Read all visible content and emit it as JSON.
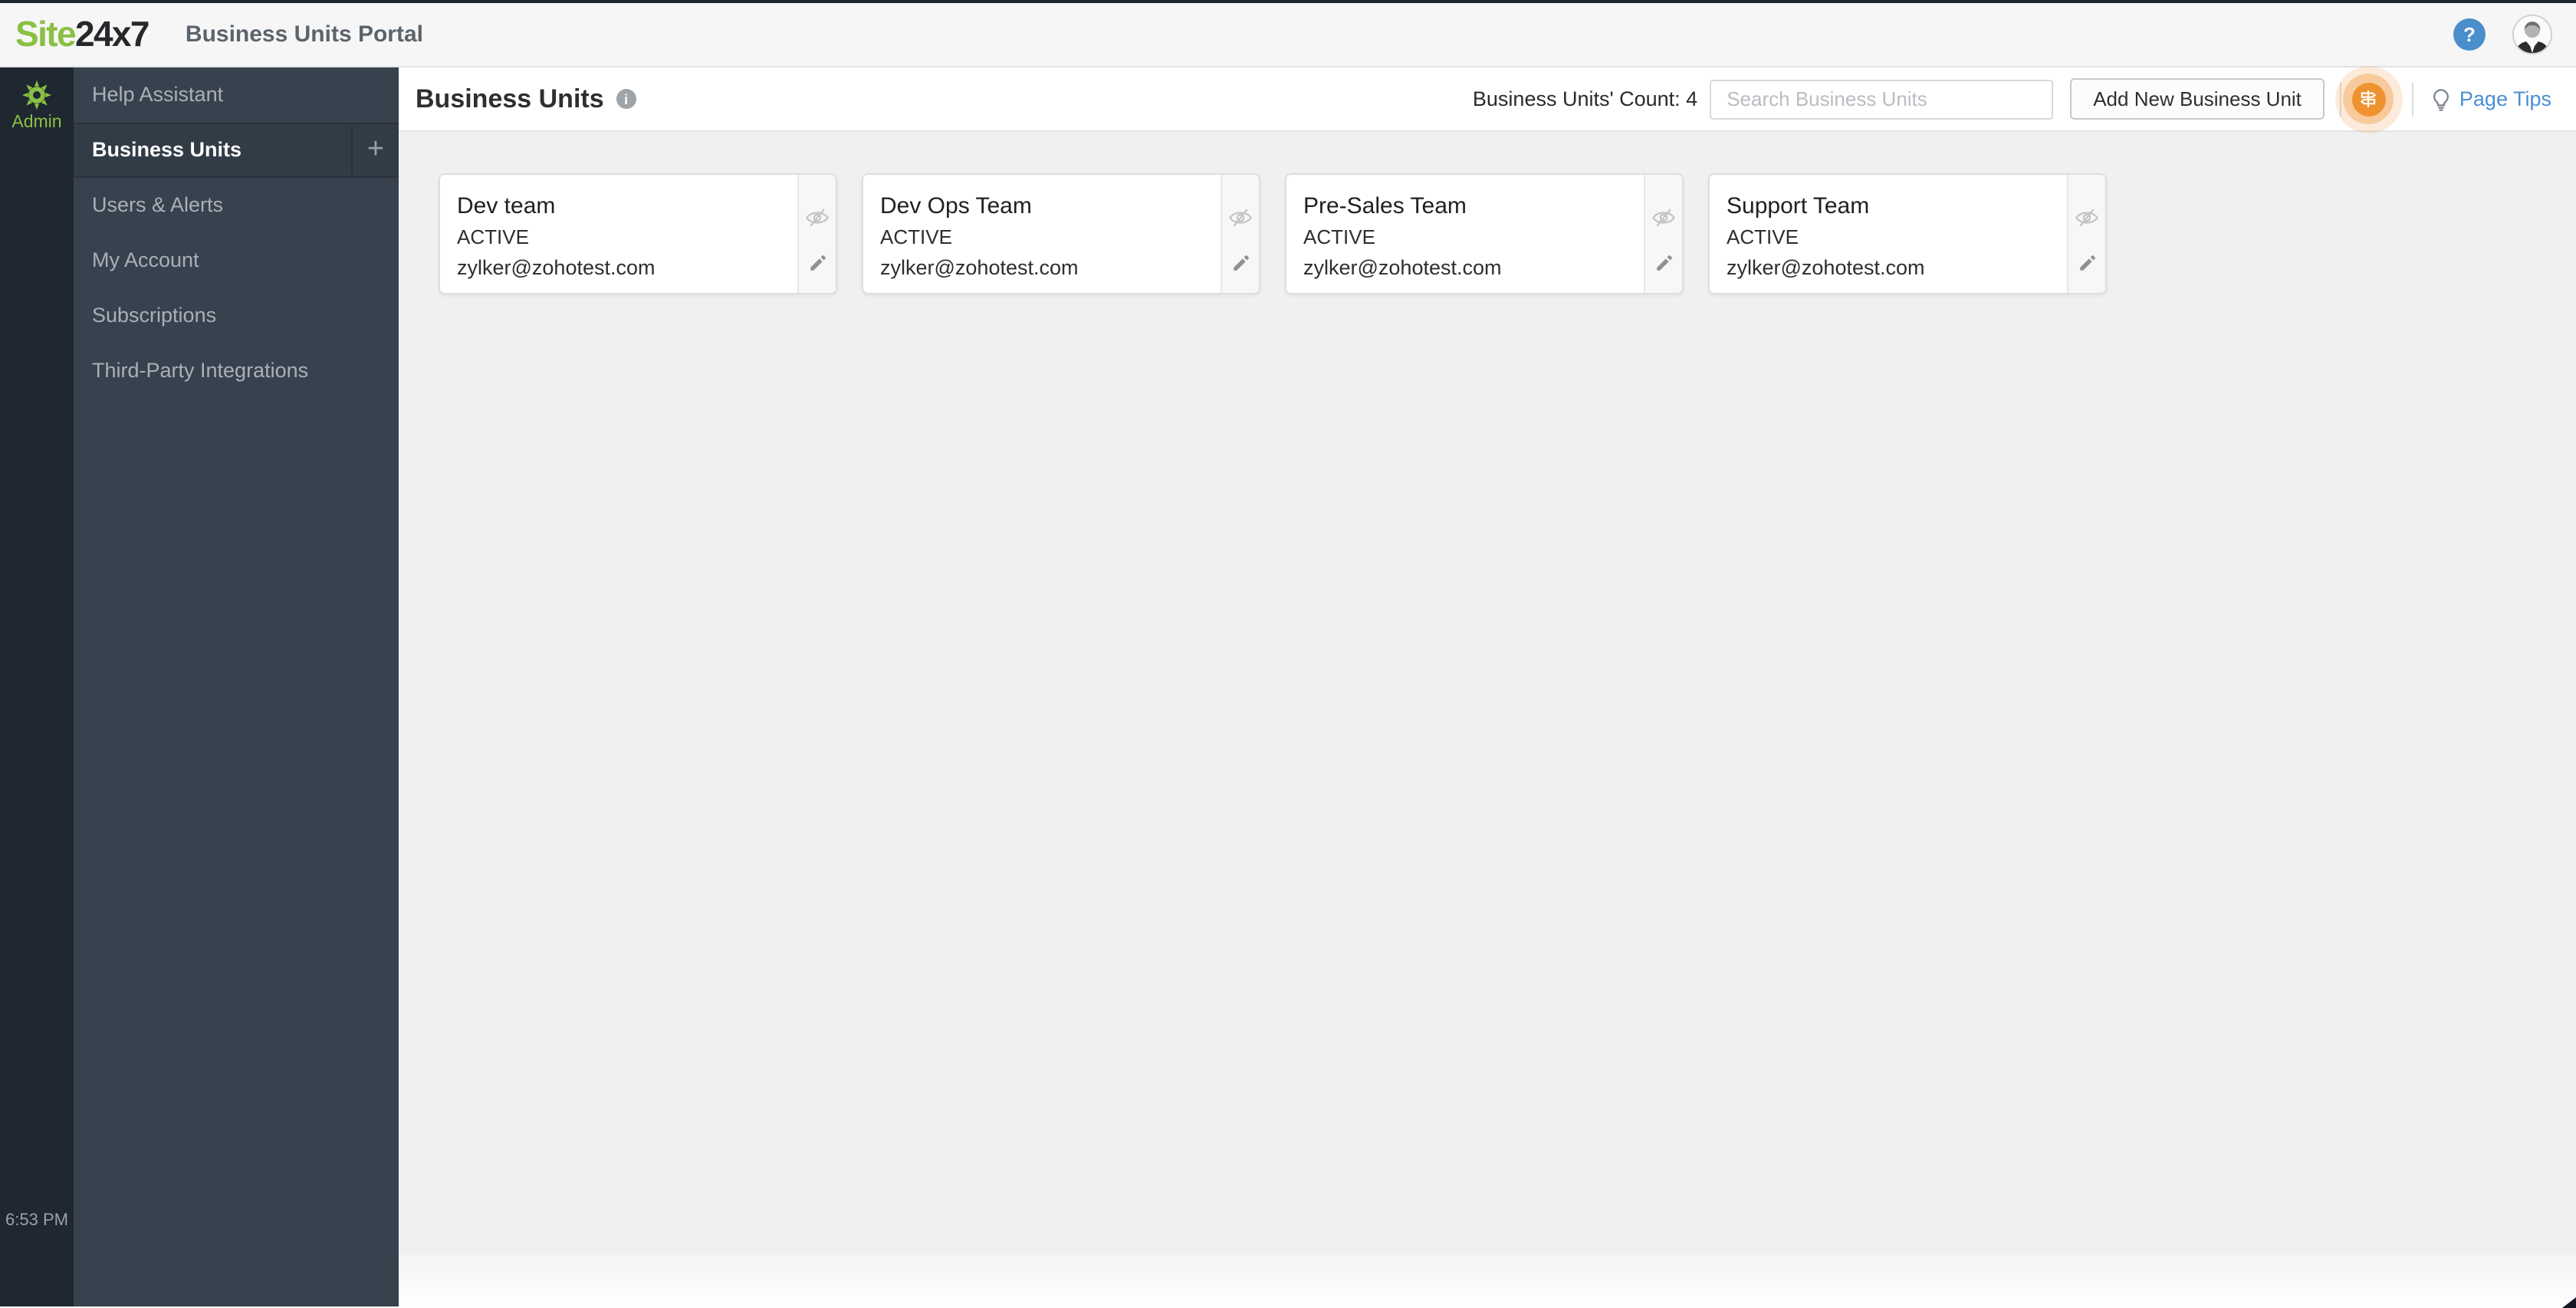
{
  "topbar": {
    "logo": {
      "site": "Site",
      "suffix": "24x7"
    },
    "portal_title": "Business Units Portal",
    "help_glyph": "?"
  },
  "admin_rail": {
    "label": "Admin",
    "time": "6:53 PM"
  },
  "sidebar": {
    "items": [
      {
        "label": "Help Assistant"
      },
      {
        "label": "Business Units",
        "active": true,
        "add_glyph": "+"
      },
      {
        "label": "Users & Alerts"
      },
      {
        "label": "My Account"
      },
      {
        "label": "Subscriptions"
      },
      {
        "label": "Third-Party Integrations"
      }
    ]
  },
  "header": {
    "title": "Business Units",
    "info_glyph": "i",
    "count_text": "Business Units' Count: 4",
    "search_placeholder": "Search Business Units",
    "add_button_label": "Add New Business Unit",
    "page_tips_label": "Page Tips"
  },
  "business_units": [
    {
      "name": "Dev team",
      "status": "ACTIVE",
      "email": "zylker@zohotest.com"
    },
    {
      "name": "Dev Ops Team",
      "status": "ACTIVE",
      "email": "zylker@zohotest.com"
    },
    {
      "name": "Pre-Sales Team",
      "status": "ACTIVE",
      "email": "zylker@zohotest.com"
    },
    {
      "name": "Support Team",
      "status": "ACTIVE",
      "email": "zylker@zohotest.com"
    }
  ],
  "icons": {
    "rail": [
      "admin-gear-icon"
    ],
    "topbar": [
      "help-icon",
      "user-avatar"
    ],
    "header": [
      "info-icon",
      "guided-tour-signpost-icon",
      "lightbulb-icon"
    ],
    "card": [
      "eye-slash-icon",
      "edit-pencil-icon"
    ]
  },
  "colors": {
    "brand_green": "#8ac043",
    "topstrip": "#20262e",
    "rail_bg": "#1f2730",
    "sidebar_bg": "#38424e",
    "sidebar_active_bg": "#323c47",
    "content_bg": "#eff0f2",
    "link_blue": "#4a8fd2",
    "help_blue": "#4a8ecb",
    "accent_orange": "#ee9330"
  }
}
